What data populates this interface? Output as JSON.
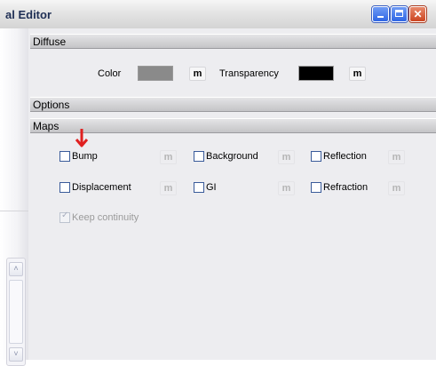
{
  "window": {
    "title": "al Editor",
    "min_glyph": "",
    "max_glyph": "",
    "close_glyph": "✕"
  },
  "sections": {
    "diffuse": "Diffuse",
    "options": "Options",
    "maps": "Maps"
  },
  "diffuse": {
    "color_label": "Color",
    "color_value": "#8a8a8a",
    "color_map_button": "m",
    "transparency_label": "Transparency",
    "transparency_value": "#000000",
    "transparency_map_button": "m"
  },
  "maps": {
    "items": [
      {
        "label": "Bump",
        "checked": false,
        "map_button": "m"
      },
      {
        "label": "Background",
        "checked": false,
        "map_button": "m"
      },
      {
        "label": "Reflection",
        "checked": false,
        "map_button": "m"
      },
      {
        "label": "Displacement",
        "checked": false,
        "map_button": "m"
      },
      {
        "label": "GI",
        "checked": false,
        "map_button": "m"
      },
      {
        "label": "Refraction",
        "checked": false,
        "map_button": "m"
      }
    ],
    "keep_continuity": {
      "label": "Keep continuity",
      "checked": true,
      "enabled": false
    }
  },
  "annotation": {
    "icon": "red-down-arrow-icon",
    "color": "#e02020"
  },
  "scrollbar": {
    "up_arrow": "˄",
    "down_arrow": "˅"
  }
}
